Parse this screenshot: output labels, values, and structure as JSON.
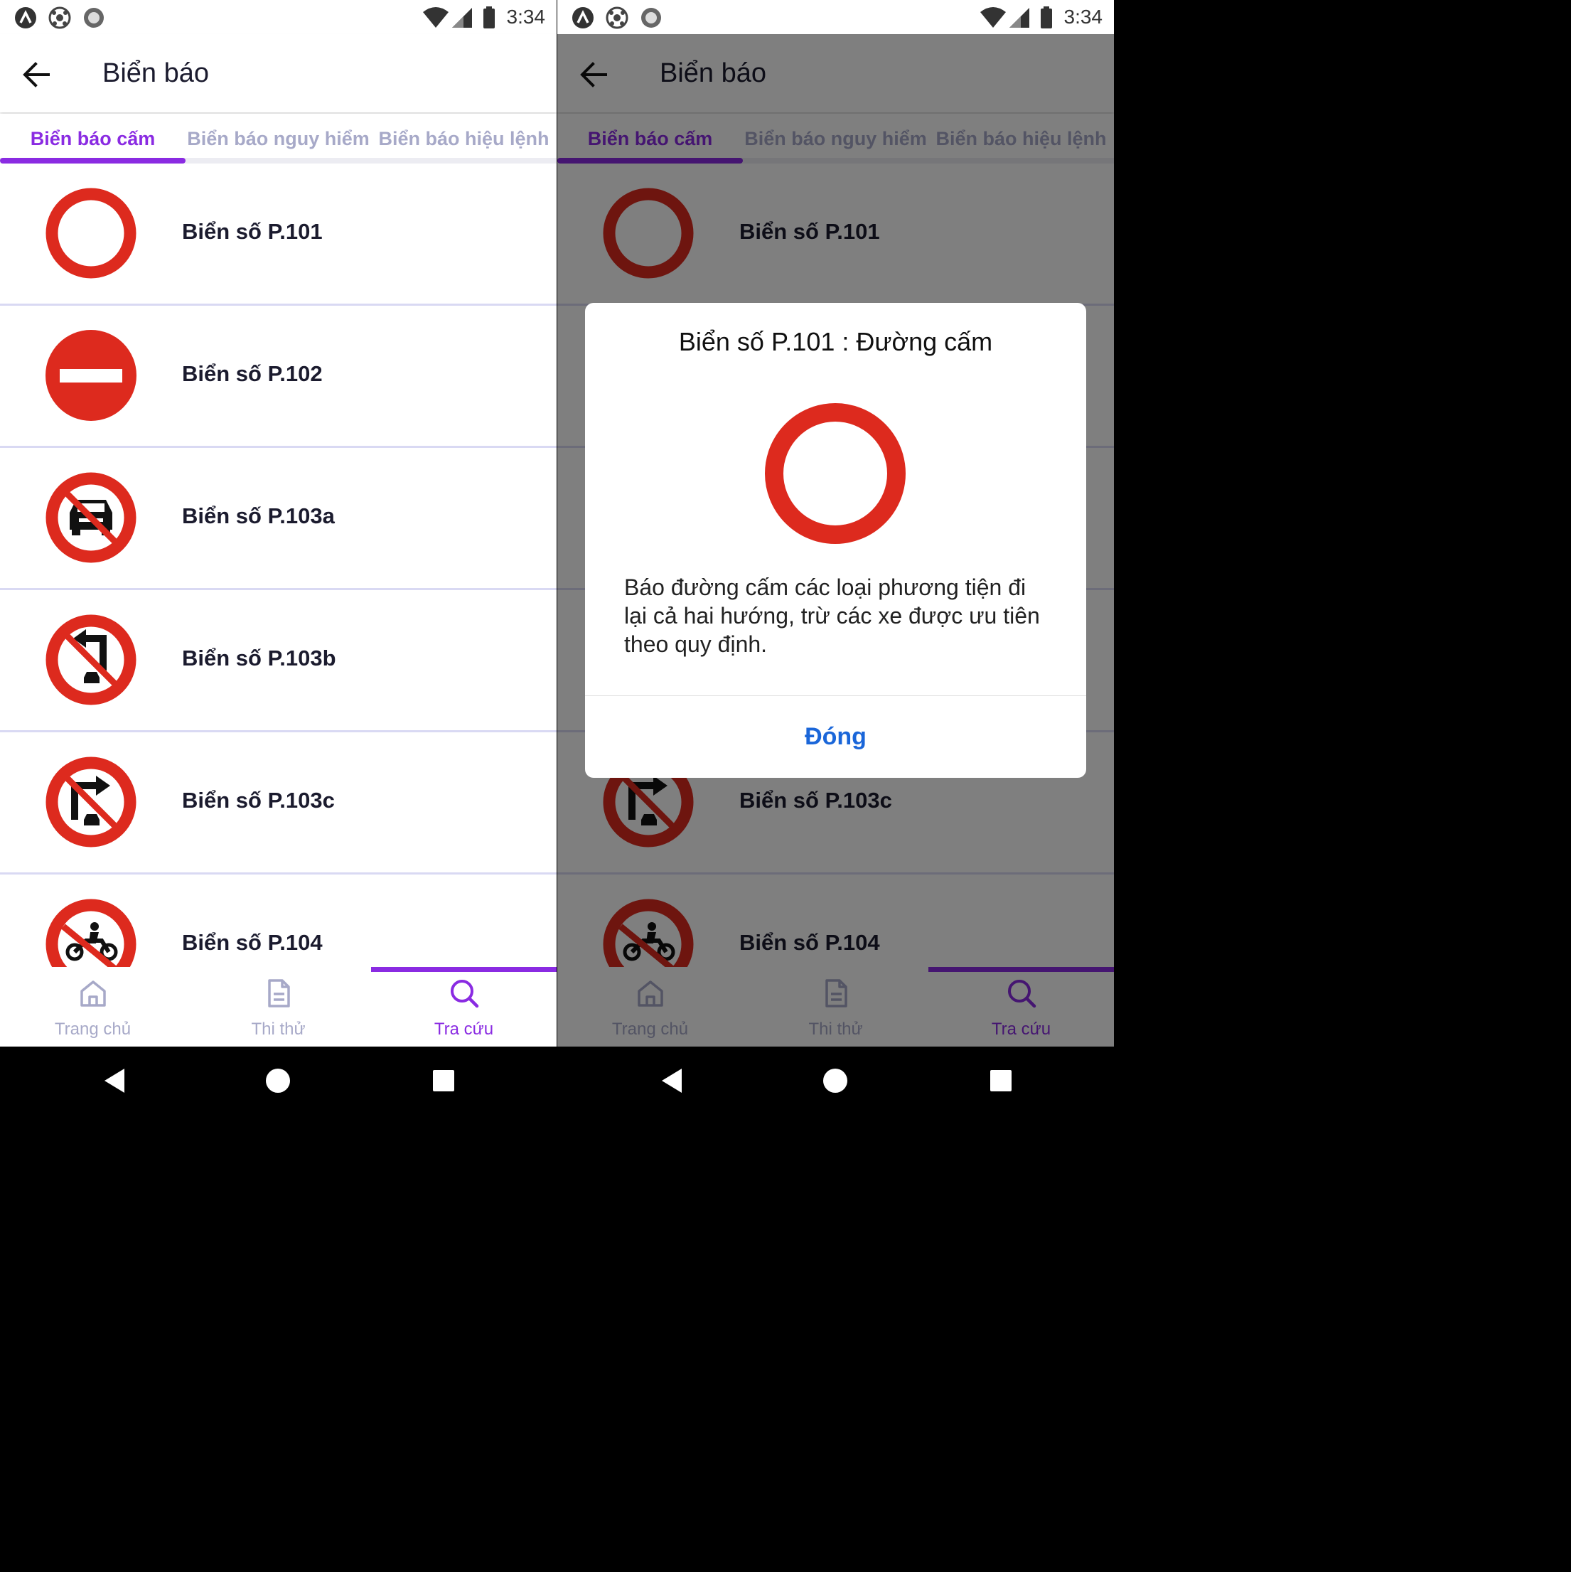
{
  "status": {
    "time": "3:34"
  },
  "appbar": {
    "title": "Biển báo"
  },
  "tabs": [
    {
      "label": "Biển báo cấm",
      "active": true
    },
    {
      "label": "Biển báo nguy hiểm",
      "active": false
    },
    {
      "label": "Biển báo hiệu lệnh",
      "active": false
    }
  ],
  "signs": [
    {
      "label": "Biển số P.101",
      "icon": "no-entry-both-directions-sign-icon"
    },
    {
      "label": "Biển số P.102",
      "icon": "no-entry-sign-icon"
    },
    {
      "label": "Biển số P.103a",
      "icon": "no-cars-sign-icon"
    },
    {
      "label": "Biển số P.103b",
      "icon": "no-cars-turn-left-sign-icon"
    },
    {
      "label": "Biển số P.103c",
      "icon": "no-cars-turn-right-sign-icon"
    },
    {
      "label": "Biển số P.104",
      "icon": "no-motorcycles-sign-icon"
    }
  ],
  "bottom_nav": [
    {
      "label": "Trang chủ",
      "icon": "home-icon",
      "active": false
    },
    {
      "label": "Thi thử",
      "icon": "document-icon",
      "active": false
    },
    {
      "label": "Tra cứu",
      "icon": "search-icon",
      "active": true
    }
  ],
  "dialog": {
    "title": "Biển số P.101 : Đường cấm",
    "description": "Báo đường cấm các loại phương tiện đi lại cả hai hướng, trừ các xe được ưu tiên theo quy định.",
    "close_label": "Đóng"
  },
  "colors": {
    "accent": "#8a2be2",
    "sign_red": "#dd2a1e",
    "tab_inactive": "#a7a9c8",
    "dialog_button": "#1a66d9"
  }
}
